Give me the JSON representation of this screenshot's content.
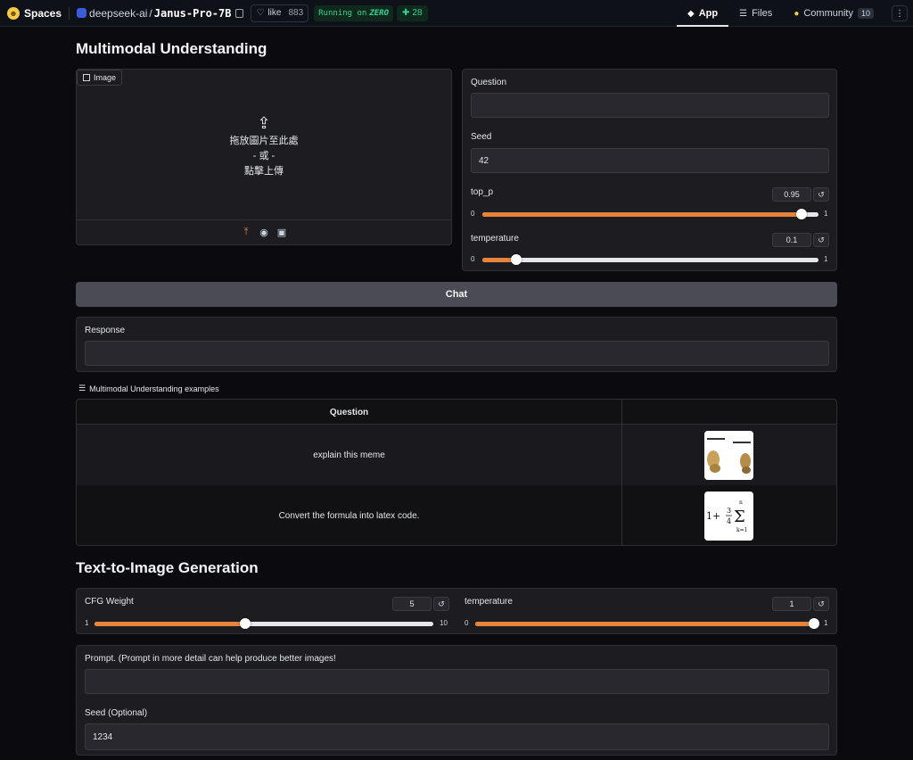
{
  "topbar": {
    "spaces_label": "Spaces",
    "owner": "deepseek-ai",
    "separator": "/",
    "repo": "Janus-Pro-7B",
    "like_label": "like",
    "like_count": "883",
    "running_label": "Running on",
    "running_hw": "ZERO",
    "badge_count": "28",
    "nav": [
      {
        "label": "App",
        "icon": "cube-icon"
      },
      {
        "label": "Files",
        "icon": "files-icon"
      },
      {
        "label": "Community",
        "icon": "community-icon",
        "count": "10"
      }
    ]
  },
  "understanding": {
    "title": "Multimodal Understanding",
    "image_tag": "Image",
    "upload_line1": "拖放圖片至此處",
    "upload_line2": "- 或 -",
    "upload_line3": "點擊上傳",
    "question_label": "Question",
    "question_value": "",
    "seed_label": "Seed",
    "seed_value": "42",
    "top_p": {
      "label": "top_p",
      "value": "0.95",
      "min": "0",
      "max": "1",
      "fraction": 0.95
    },
    "temperature": {
      "label": "temperature",
      "value": "0.1",
      "min": "0",
      "max": "1",
      "fraction": 0.1
    },
    "chat_button": "Chat",
    "response_label": "Response",
    "response_value": ""
  },
  "examples": {
    "title": "Multimodal Understanding examples",
    "header_question": "Question",
    "rows": [
      {
        "question": "explain this meme"
      },
      {
        "question": "Convert the formula into latex code."
      }
    ]
  },
  "generation": {
    "title": "Text-to-Image Generation",
    "cfg": {
      "label": "CFG Weight",
      "value": "5",
      "min": "1",
      "max": "10",
      "fraction": 0.4444
    },
    "temperature": {
      "label": "temperature",
      "value": "1",
      "min": "0",
      "max": "1",
      "fraction": 1.0
    },
    "prompt_label": "Prompt. (Prompt in more detail can help produce better images!",
    "prompt_value": "",
    "seed_label": "Seed (Optional)",
    "seed_value": "1234"
  },
  "colors": {
    "accent": "#e8833a",
    "running": "#34d399"
  }
}
